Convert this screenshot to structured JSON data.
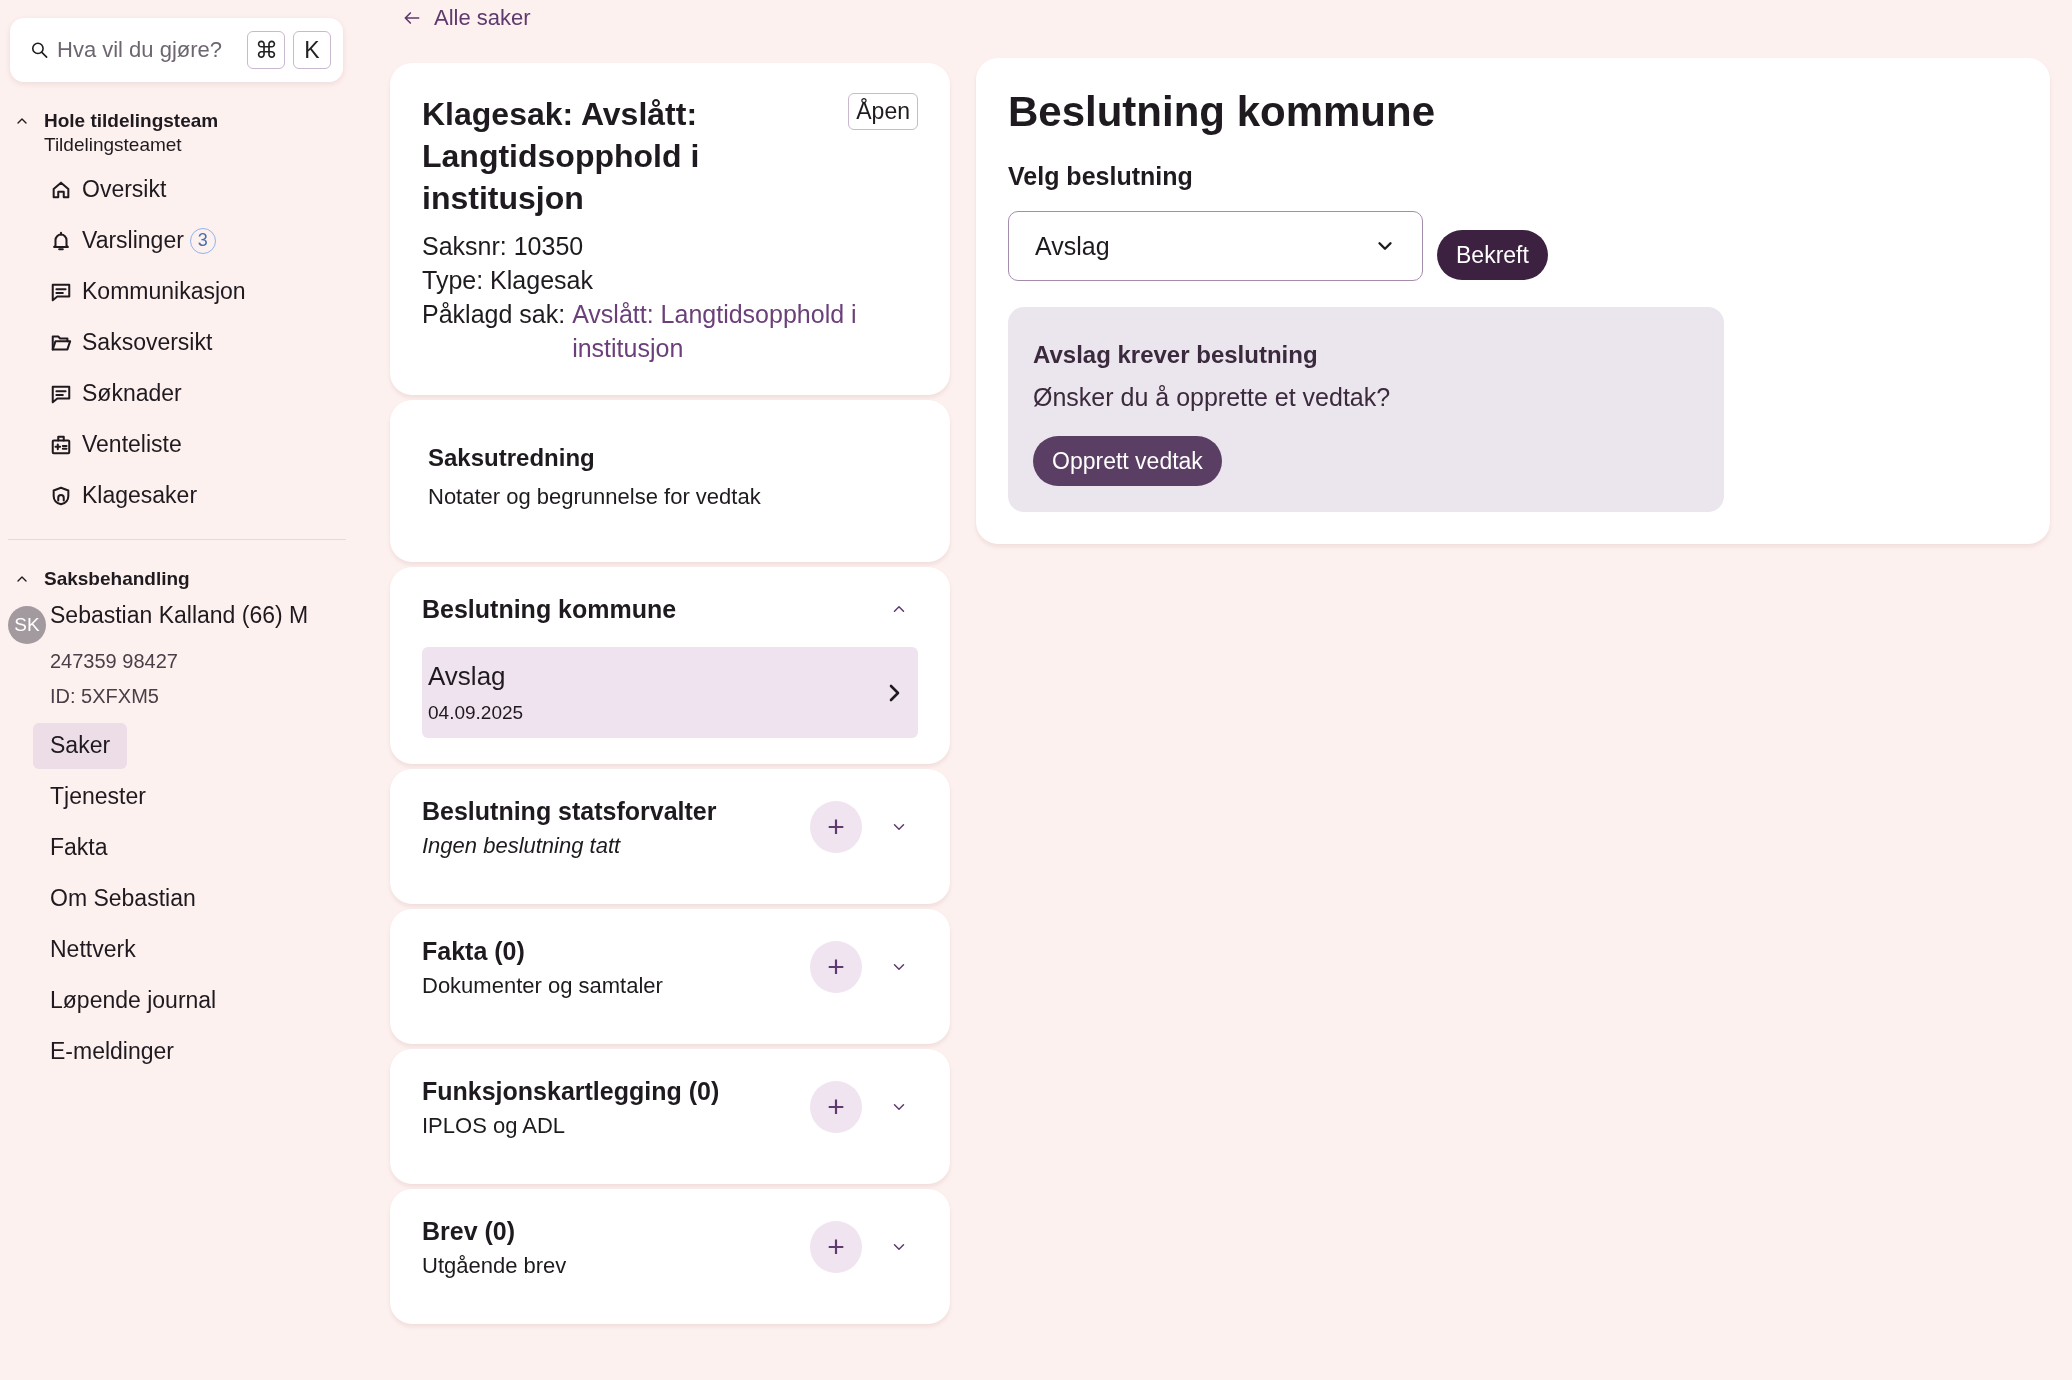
{
  "search": {
    "placeholder": "Hva vil du gjøre?",
    "keys": [
      "⌘",
      "K"
    ]
  },
  "sidebar": {
    "groups": [
      {
        "title": "Hole tildelingsteam",
        "subtitle": "Tildelingsteamet",
        "expanded": true,
        "items": [
          {
            "label": "Oversikt",
            "selected": false
          },
          {
            "label": "Varslinger",
            "badge": "3",
            "selected": false
          },
          {
            "label": "Kommunikasjon",
            "selected": false
          },
          {
            "label": "Saksoversikt",
            "selected": false
          },
          {
            "label": "Søknader",
            "selected": false
          },
          {
            "label": "Venteliste",
            "selected": false
          },
          {
            "label": "Klagesaker",
            "selected": false
          }
        ]
      },
      {
        "title": "Saksbehandling",
        "expanded": true,
        "person": {
          "initials": "SK",
          "name": "Sebastian Kalland (66) M",
          "details": [
            "247359 98427",
            "ID: 5XFXM5"
          ]
        },
        "items": [
          {
            "label": "Saker",
            "selected": true
          },
          {
            "label": "Tjenester",
            "selected": false
          },
          {
            "label": "Fakta",
            "selected": false
          },
          {
            "label": "Om Sebastian",
            "selected": false
          },
          {
            "label": "Nettverk",
            "selected": false
          },
          {
            "label": "Løpende journal",
            "selected": false
          },
          {
            "label": "E-meldinger",
            "selected": false
          }
        ]
      }
    ]
  },
  "back_link": "Alle saker",
  "case": {
    "title": "Klagesak: Avslått: Langtidsopphold i institusjon",
    "status": "Åpen",
    "lines": [
      "Saksnr: 10350",
      "Type: Klagesak"
    ],
    "appealed": {
      "label": "Påklagd sak:",
      "link": "Avslått: Langtidsopphold i institusjon"
    }
  },
  "sections": [
    {
      "kind": "link",
      "title": "Saksutredning",
      "subtitle": "Notater og begrunnelse for vedtak"
    },
    {
      "kind": "accordion",
      "title": "Beslutning kommune",
      "expanded": true,
      "entries": [
        {
          "title": "Avslag",
          "date": "04.09.2025"
        }
      ]
    },
    {
      "kind": "accordion",
      "title": "Beslutning statsforvalter",
      "subtitle": "Ingen beslutning tatt",
      "empty": true,
      "expanded": false,
      "add": "+"
    },
    {
      "kind": "accordion",
      "title": "Fakta (0)",
      "subtitle": "Dokumenter og samtaler",
      "expanded": false,
      "add": "+"
    },
    {
      "kind": "accordion",
      "title": "Funksjonskartlegging (0)",
      "subtitle": "IPLOS og ADL",
      "expanded": false,
      "add": "+"
    },
    {
      "kind": "accordion",
      "title": "Brev (0)",
      "subtitle": "Utgående brev",
      "expanded": false,
      "add": "+"
    }
  ],
  "decision": {
    "title": "Beslutning kommune",
    "field_label": "Velg beslutning",
    "value": "Avslag",
    "confirm": "Bekreft",
    "alert": {
      "title": "Avslag krever beslutning",
      "text": "Ønsker du å opprette et vedtak?",
      "button": "Opprett vedtak"
    }
  }
}
